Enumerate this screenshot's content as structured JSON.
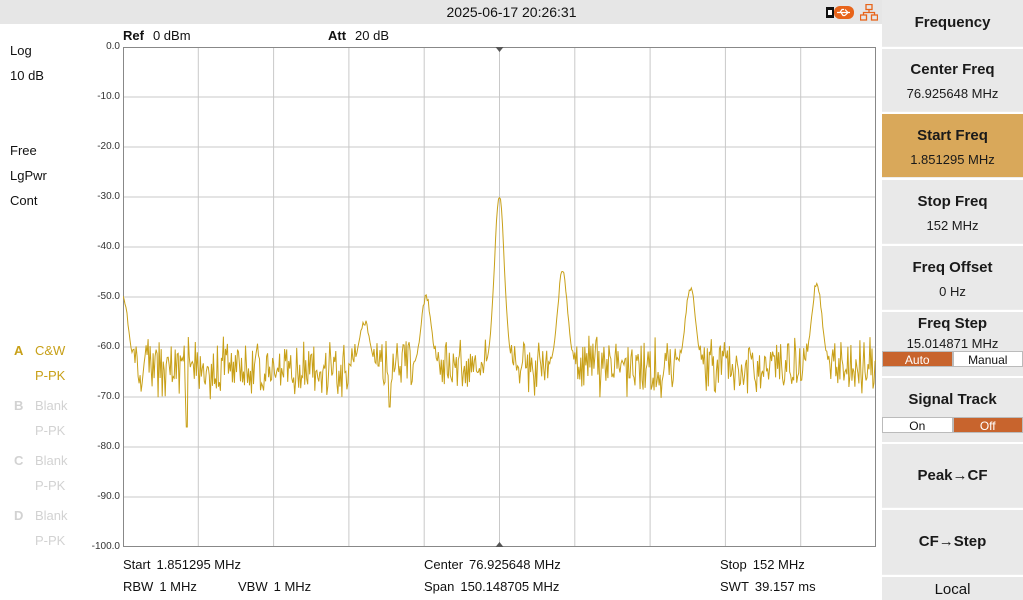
{
  "status": {
    "datetime": "2025-06-17 20:26:31"
  },
  "colors": {
    "trace": "#c8a018",
    "accent": "#d9a85a",
    "toggle_on": "#c8642d",
    "grid": "#c9c9c9"
  },
  "icons": {
    "usb": "usb-icon",
    "network": "network-icon"
  },
  "left_info": {
    "scale": "Log",
    "division": "10 dB",
    "trigger": "Free",
    "detector": "LgPwr",
    "sweep": "Cont"
  },
  "traces": [
    {
      "letter": "A",
      "mode": "C&W",
      "detector": "P-PK",
      "active": true
    },
    {
      "letter": "B",
      "mode": "Blank",
      "detector": "P-PK",
      "active": false
    },
    {
      "letter": "C",
      "mode": "Blank",
      "detector": "P-PK",
      "active": false
    },
    {
      "letter": "D",
      "mode": "Blank",
      "detector": "P-PK",
      "active": false
    }
  ],
  "header": {
    "ref_label": "Ref",
    "ref_value": "0 dBm",
    "att_label": "Att",
    "att_value": "20 dB"
  },
  "y_ticks": [
    "0.0",
    "-10.0",
    "-20.0",
    "-30.0",
    "-40.0",
    "-50.0",
    "-60.0",
    "-70.0",
    "-80.0",
    "-90.0",
    "-100.0"
  ],
  "bottom": {
    "start_label": "Start",
    "start_value": "1.851295 MHz",
    "center_label": "Center",
    "center_value": "76.925648 MHz",
    "stop_label": "Stop",
    "stop_value": "152 MHz",
    "rbw_label": "RBW",
    "rbw_value": "1 MHz",
    "vbw_label": "VBW",
    "vbw_value": "1 MHz",
    "span_label": "Span",
    "span_value": "150.148705 MHz",
    "swt_label": "SWT",
    "swt_value": "39.157 ms"
  },
  "menu": {
    "title": "Frequency",
    "center": {
      "label": "Center Freq",
      "value": "76.925648 MHz"
    },
    "start": {
      "label": "Start Freq",
      "value": "1.851295 MHz"
    },
    "stop": {
      "label": "Stop Freq",
      "value": "152 MHz"
    },
    "offset": {
      "label": "Freq Offset",
      "value": "0 Hz"
    },
    "step": {
      "label": "Freq Step",
      "value": "15.014871 MHz",
      "opt_auto": "Auto",
      "opt_manual": "Manual",
      "selected": "Auto"
    },
    "signal_track": {
      "label": "Signal Track",
      "opt_on": "On",
      "opt_off": "Off",
      "selected": "Off"
    },
    "peak_cf": "Peak→CF",
    "cf_step": "CF→Step",
    "local": "Local"
  },
  "chart_data": {
    "type": "line",
    "x_unit": "MHz",
    "x_range": [
      1.851295,
      152
    ],
    "ylim": [
      -100,
      0
    ],
    "y_unit": "dBm",
    "grid": true,
    "noise_floor": -64,
    "peaks": [
      {
        "x": 1.9,
        "y": -50
      },
      {
        "x": 50.0,
        "y": -55
      },
      {
        "x": 62.3,
        "y": -50
      },
      {
        "x": 76.9,
        "y": -30
      },
      {
        "x": 89.5,
        "y": -45
      },
      {
        "x": 115.0,
        "y": -48
      },
      {
        "x": 140.2,
        "y": -47
      }
    ],
    "dips": [
      {
        "x": 14.6,
        "y": -76
      },
      {
        "x": 55.0,
        "y": -72
      }
    ]
  }
}
